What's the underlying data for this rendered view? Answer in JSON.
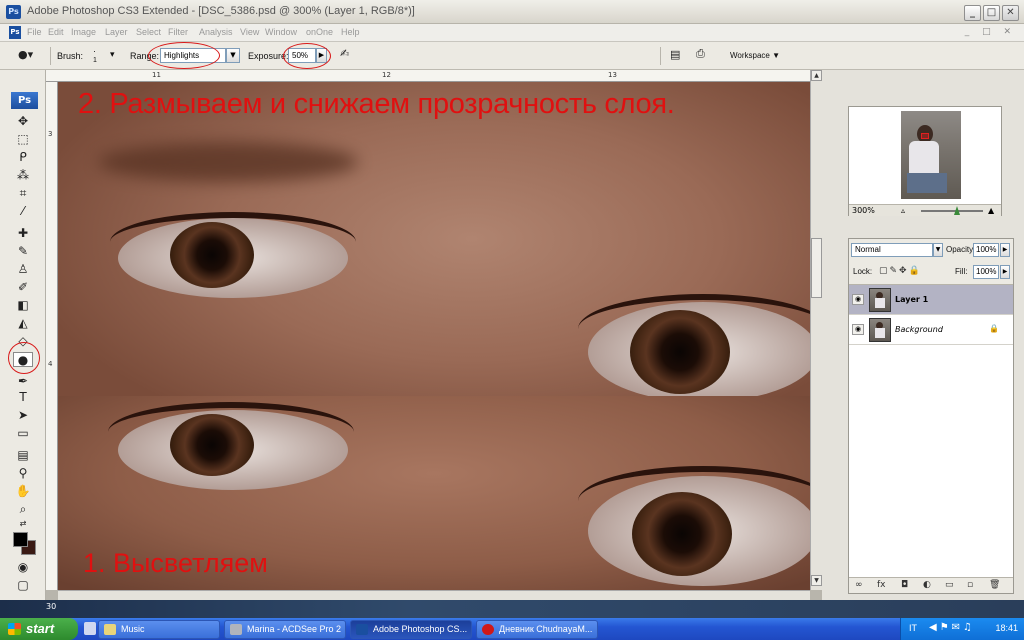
{
  "window": {
    "app_icon": "Ps",
    "title": "Adobe Photoshop CS3 Extended - [DSC_5386.psd @ 300% (Layer 1, RGB/8*)]",
    "minimize_icon": "minimize-icon",
    "maximize_icon": "maximize-icon",
    "close_icon": "close-icon"
  },
  "menubar": {
    "items": [
      "File",
      "Edit",
      "Image",
      "Layer",
      "Select",
      "Filter",
      "Analysis",
      "View",
      "Window",
      "onOne",
      "Help"
    ]
  },
  "options": {
    "brush_label": "Brush:",
    "brush_size": "1",
    "range_label": "Range:",
    "range_value": "Highlights",
    "exposure_label": "Exposure:",
    "exposure_value": "50%",
    "workspace_label": "Workspace ▼"
  },
  "toolbox": {
    "badge": "Ps",
    "tools": [
      "move-tool",
      "marquee-tool",
      "lasso-tool",
      "magic-wand-tool",
      "crop-tool",
      "slice-tool",
      "healing-brush-tool",
      "brush-tool",
      "clone-stamp-tool",
      "history-brush-tool",
      "eraser-tool",
      "paint-bucket-tool",
      "blur-tool",
      "dodge-tool",
      "pen-tool",
      "type-tool",
      "path-selection-tool",
      "shape-tool",
      "notes-tool",
      "eyedropper-tool",
      "hand-tool",
      "zoom-tool"
    ],
    "selected_tool": "dodge-tool",
    "foreground_color": "#000000",
    "background_color": "#3a1a14"
  },
  "rulers": {
    "h_marks": [
      "11",
      "12",
      "13"
    ],
    "v_marks": [
      "3",
      "4"
    ]
  },
  "canvas": {
    "annotation_top": "2. Размываем и снижаем прозрачность слоя.",
    "annotation_bottom": "1. Высветляем",
    "annotation_color": "#e01010"
  },
  "navigator": {
    "zoom": "300%"
  },
  "layers": {
    "blend_mode": "Normal",
    "opacity_label": "Opacity:",
    "opacity_value": "100%",
    "lock_label": "Lock:",
    "fill_label": "Fill:",
    "fill_value": "100%",
    "rows": [
      {
        "name": "Layer 1",
        "selected": true
      },
      {
        "name": "Background",
        "selected": false,
        "locked": true
      }
    ],
    "footer_icons": [
      "link-icon",
      "fx-icon",
      "mask-icon",
      "adjustment-icon",
      "group-icon",
      "new-layer-icon",
      "trash-icon"
    ]
  },
  "taskbar": {
    "start_label": "start",
    "tasks": [
      {
        "label": "Music",
        "active": false
      },
      {
        "label": "Marina - ACDSee Pro 2",
        "active": false
      },
      {
        "label": "Adobe Photoshop CS...",
        "active": true
      },
      {
        "label": "Дневник ChudnayaM...",
        "active": false
      }
    ],
    "language": "IT",
    "time": "18:41"
  },
  "desktop": {
    "side_label": "30"
  }
}
